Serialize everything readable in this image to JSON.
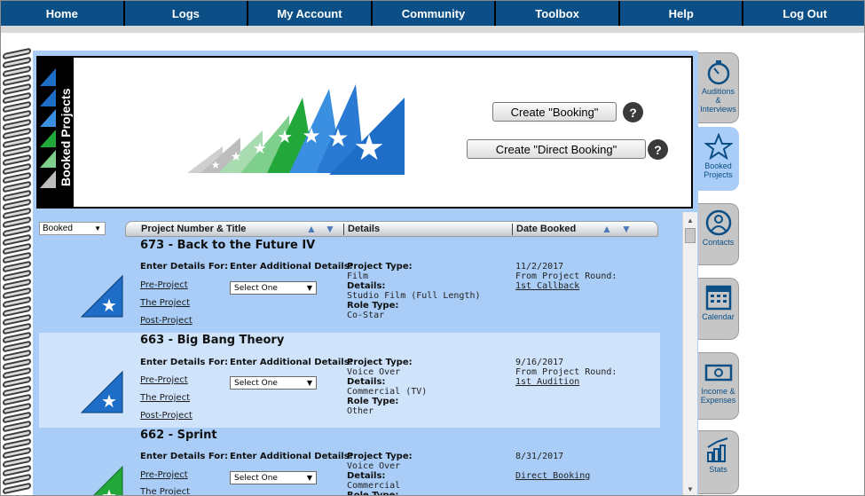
{
  "nav": [
    "Home",
    "Logs",
    "My Account",
    "Community",
    "Toolbox",
    "Help",
    "Log Out"
  ],
  "banner": {
    "title": "Booked Projects",
    "create_booking_label": "Create \"Booking\"",
    "create_direct_booking_label": "Create \"Direct Booking\"",
    "help_glyph": "?"
  },
  "filter": {
    "value": "Booked"
  },
  "columns": {
    "title": "Project Number & Title",
    "details": "Details",
    "date": "Date Booked"
  },
  "labels": {
    "enter_details": "Enter Details For:",
    "enter_additional": "Enter Additional Details:",
    "pre_project": "Pre-Project",
    "the_project": "The Project",
    "post_project": "Post-Project",
    "select_one": "Select One",
    "project_type": "Project Type:",
    "details": "Details:",
    "role_type": "Role Type:",
    "from_round": "From Project Round:"
  },
  "rows": [
    {
      "title": "673 - Back to the Future IV",
      "project_type": "Film",
      "details": "Studio Film (Full Length)",
      "role_type": "Co-Star",
      "date": "11/2/2017",
      "round": "1st Callback",
      "icon_color": "#1e6ec8"
    },
    {
      "title": "663 - Big Bang Theory",
      "project_type": "Voice Over",
      "details": "Commercial (TV)",
      "role_type": "Other",
      "date": "9/16/2017",
      "round": "1st Audition",
      "icon_color": "#1e6ec8"
    },
    {
      "title": "662 - Sprint",
      "project_type": "Voice Over",
      "details": "Commercial",
      "role_type": "",
      "date": "8/31/2017",
      "round": "Direct Booking",
      "icon_color": "#22a83a"
    }
  ],
  "tabs": [
    {
      "label": "Auditions & Interviews",
      "icon": "stopwatch-icon"
    },
    {
      "label": "Booked Projects",
      "icon": "star-icon"
    },
    {
      "label": "Contacts",
      "icon": "person-icon"
    },
    {
      "label": "Calendar",
      "icon": "calendar-icon"
    },
    {
      "label": "Income & Expenses",
      "icon": "money-icon"
    },
    {
      "label": "Stats",
      "icon": "bar-chart-icon"
    }
  ],
  "colors": {
    "nav_bg": "#0b4f86",
    "notebook_bg": "#a9cdf6",
    "row_alt": "#cfe3fb",
    "tab_inactive": "#c6c6c6"
  }
}
